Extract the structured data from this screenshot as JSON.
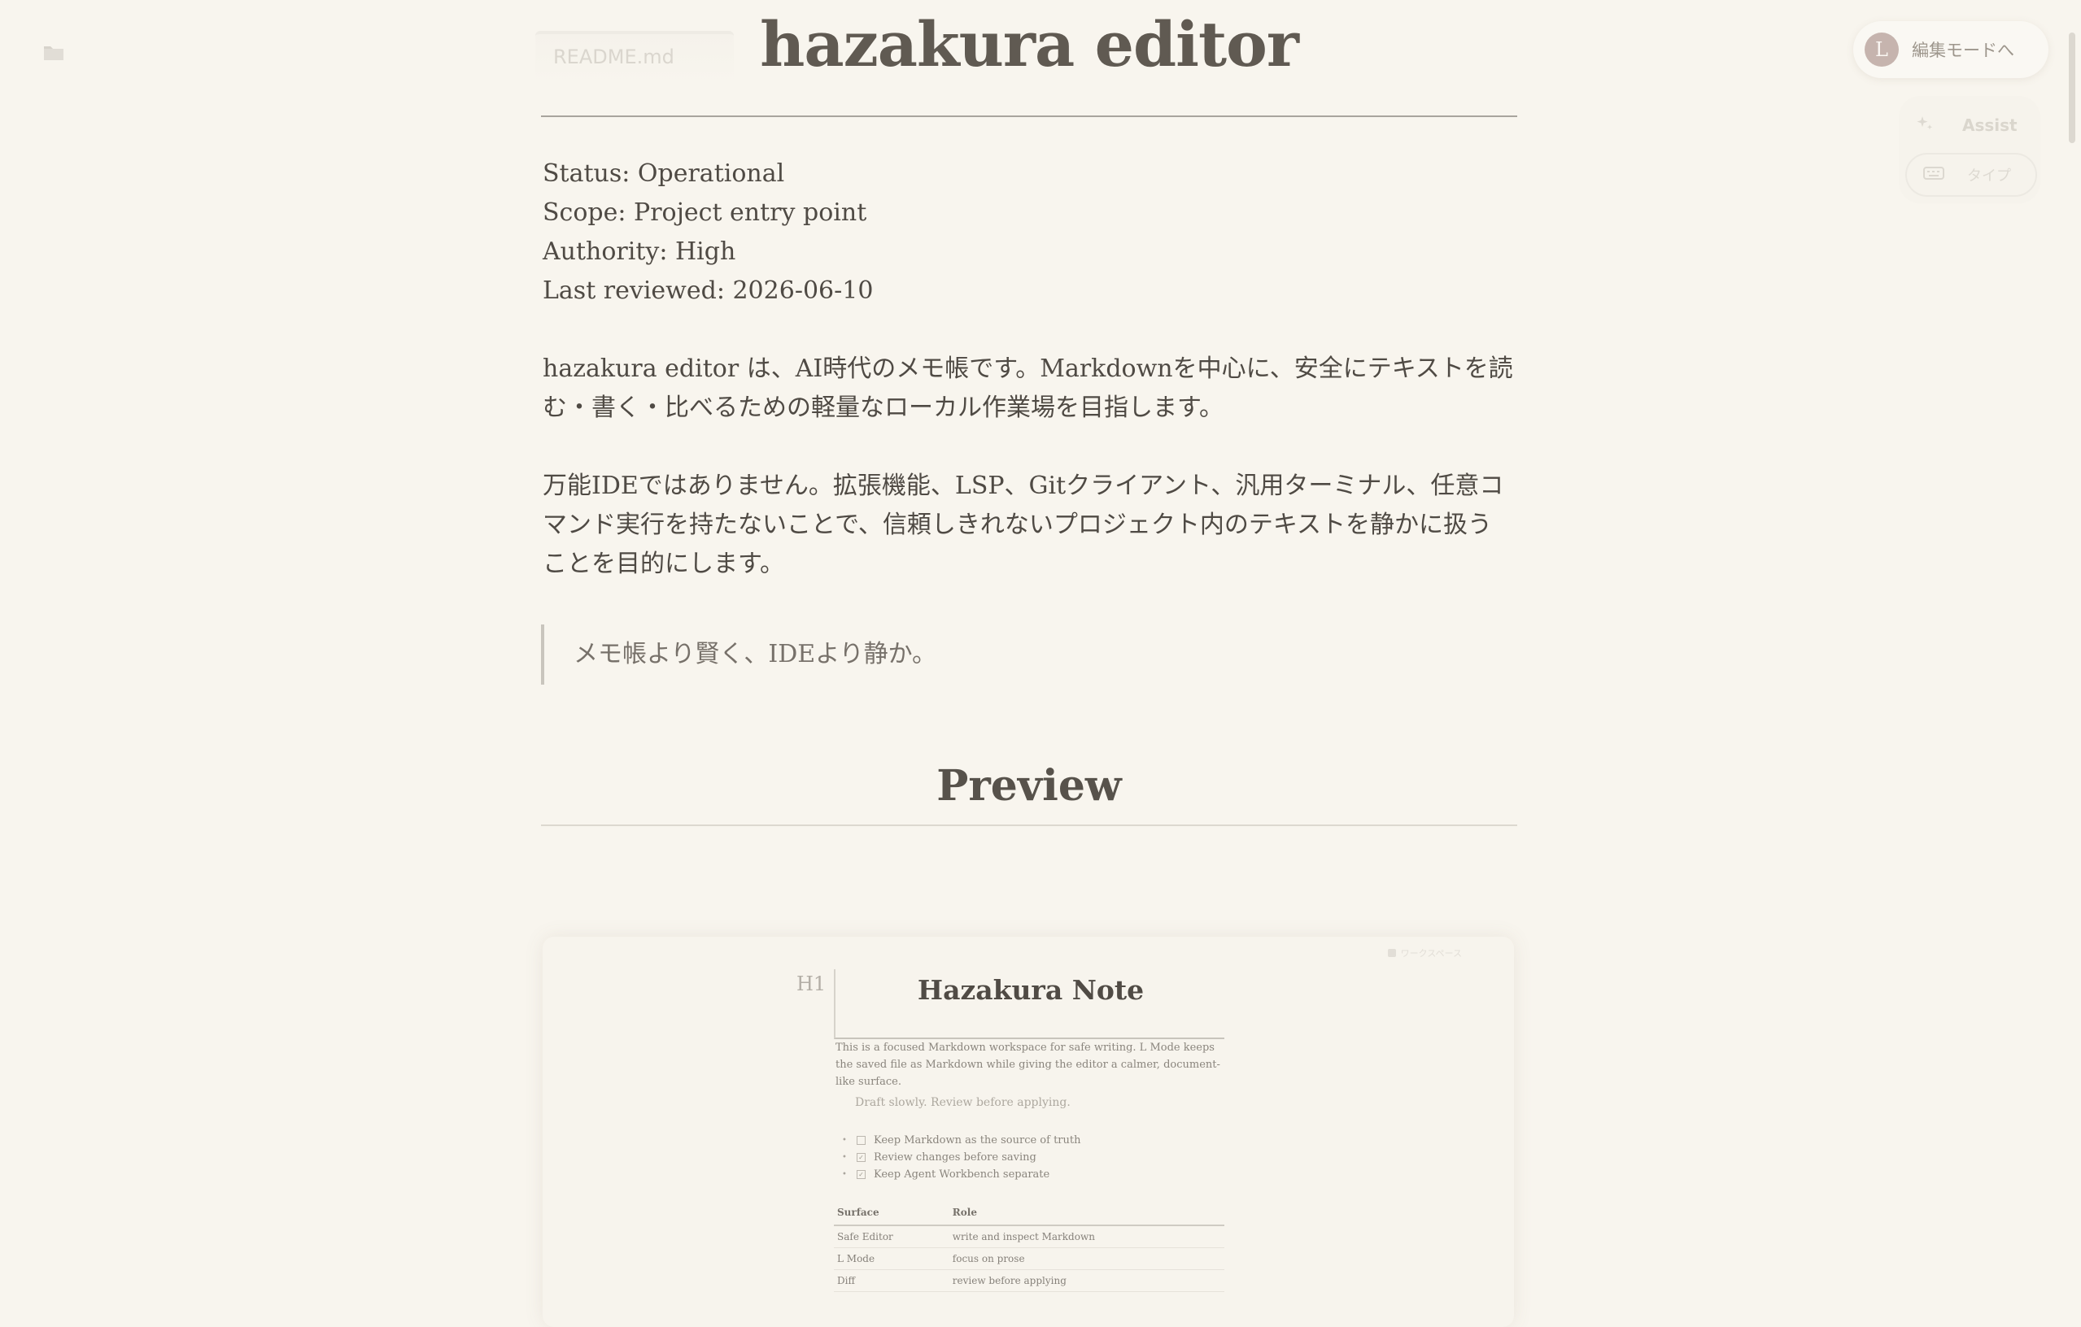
{
  "tab": {
    "label": "README.md"
  },
  "topbar": {
    "avatar_initial": "L",
    "mode_button_label": "編集モードへ",
    "assist_label": "Assist",
    "type_label": "タイプ"
  },
  "doc": {
    "title": "hazakura editor",
    "meta": [
      "Status: Operational",
      "Scope: Project entry point",
      "Authority: High",
      "Last reviewed: 2026-06-10"
    ],
    "para1": "hazakura editor は、AI時代のメモ帳です。Markdownを中心に、安全にテキストを読む・書く・比べるための軽量なローカル作業場を目指します。",
    "para2": "万能IDEではありません。拡張機能、LSP、Gitクライアント、汎用ターミナル、任意コマンド実行を持たないことで、信頼しきれないプロジェクト内のテキストを静かに扱うことを目的にします。",
    "quote": "メモ帳より賢く、IDEより静か。",
    "section_heading": "Preview"
  },
  "preview": {
    "status_label": "ワークスペース",
    "h1_marker": "H1",
    "title": "Hazakura Note",
    "body": "This is a focused Markdown workspace for safe writing. L Mode keeps the saved file as Markdown while giving the editor a calmer, document-like surface.",
    "quote": "Draft slowly. Review before applying.",
    "tasks": [
      {
        "label": "Keep Markdown as the source of truth",
        "checked": false
      },
      {
        "label": "Review changes before saving",
        "checked": true
      },
      {
        "label": "Keep Agent Workbench separate",
        "checked": true
      }
    ],
    "table": {
      "headers": [
        "Surface",
        "Role"
      ],
      "rows": [
        [
          "Safe Editor",
          "write and inspect Markdown"
        ],
        [
          "L Mode",
          "focus on prose"
        ],
        [
          "Diff",
          "review before applying"
        ]
      ]
    }
  },
  "colors": {
    "background": "#f8f5ee",
    "text": "#4f4a44",
    "avatar": "#c6b4ae",
    "rule": "#a8a49d"
  },
  "icons": {
    "folder": "folder-icon",
    "assist": "sparkle-icon",
    "type": "keyboard-icon"
  }
}
